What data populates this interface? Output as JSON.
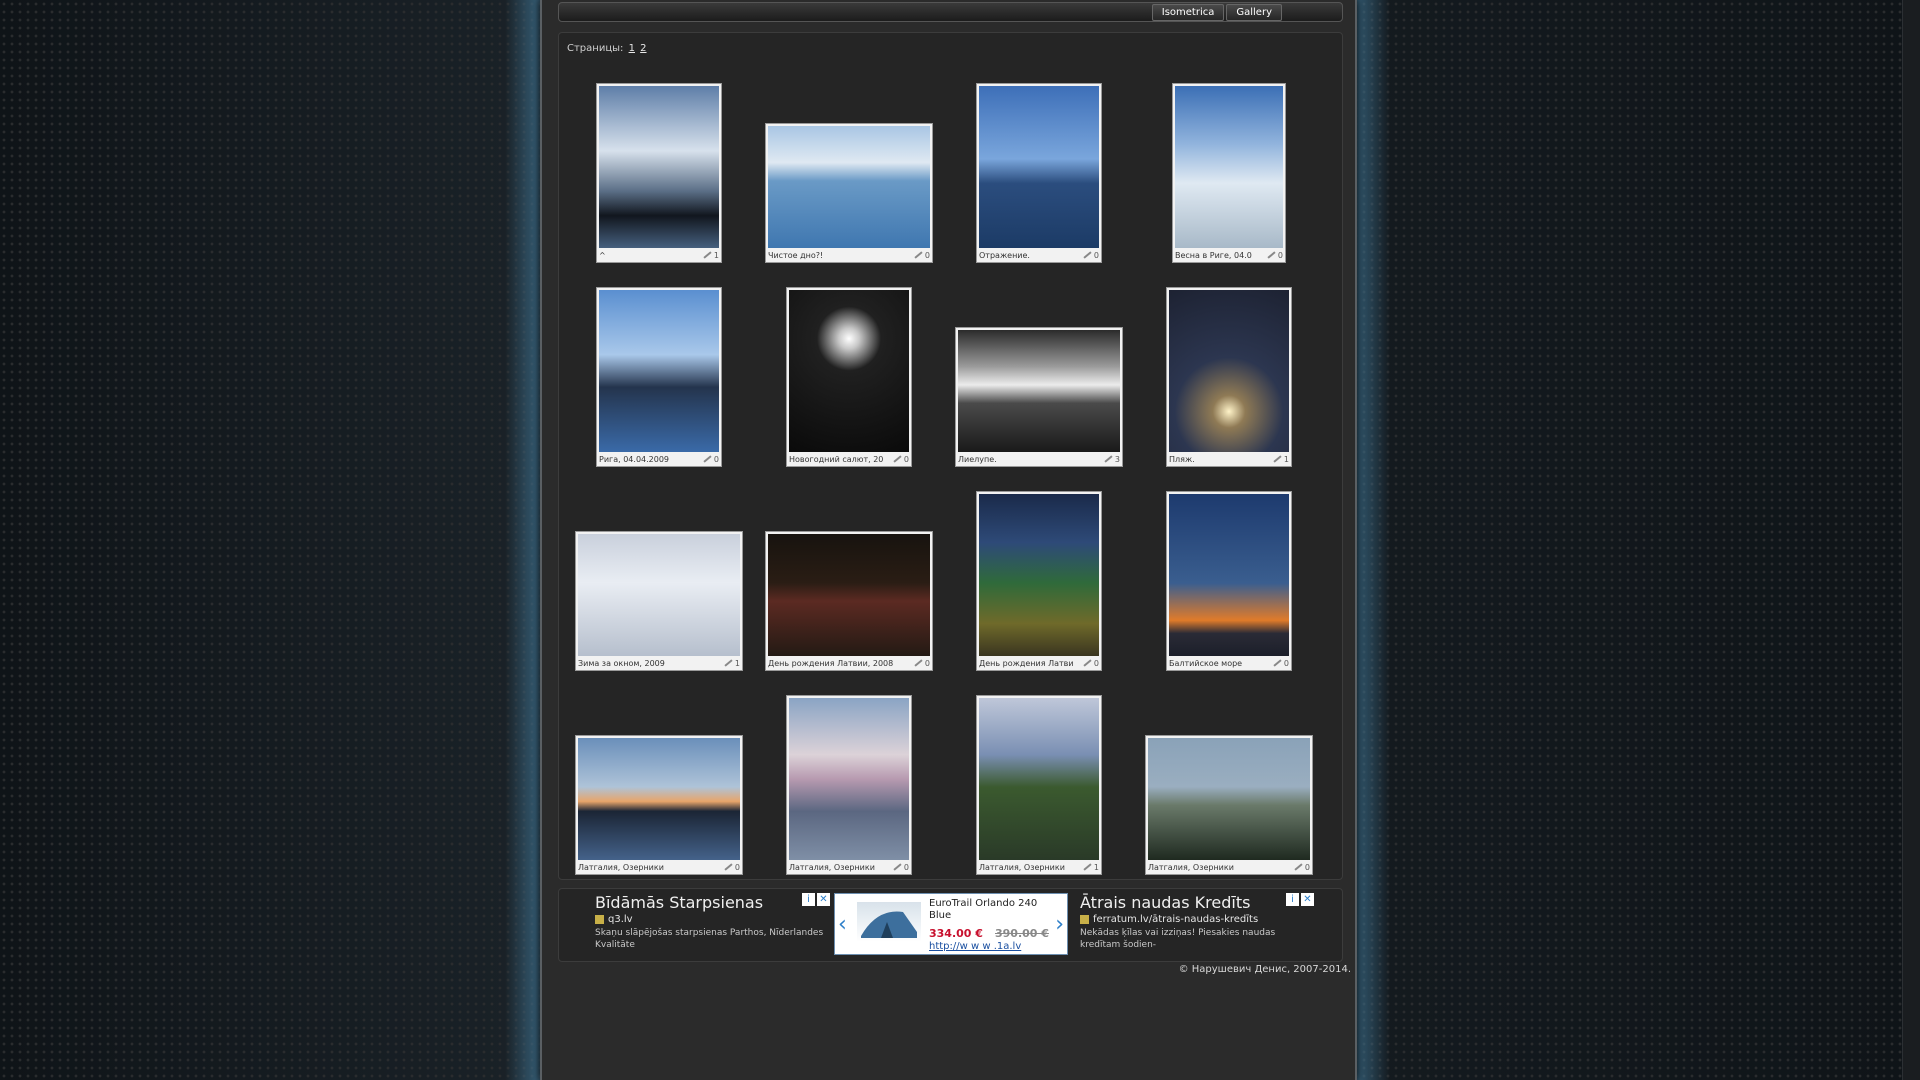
{
  "nav": {
    "tabs": [
      "Isometrica",
      "Gallery"
    ]
  },
  "pager": {
    "label": "Страницы:",
    "pages": [
      "1",
      "2"
    ]
  },
  "photos": [
    {
      "caption": "^",
      "comments": "1"
    },
    {
      "caption": "Чистое дно?!",
      "comments": "0"
    },
    {
      "caption": "Отражение.",
      "comments": "0"
    },
    {
      "caption": "Весна в Риге, 04.0",
      "comments": "0"
    },
    {
      "caption": "Рига, 04.04.2009",
      "comments": "0"
    },
    {
      "caption": "Новогодний салют, 20",
      "comments": "0"
    },
    {
      "caption": "Лиелупе.",
      "comments": "3"
    },
    {
      "caption": "Пляж.",
      "comments": "1"
    },
    {
      "caption": "Зима за окном, 2009",
      "comments": "1"
    },
    {
      "caption": "День рождения Латвии, 2008",
      "comments": "0"
    },
    {
      "caption": "День рождения Латви",
      "comments": "0"
    },
    {
      "caption": "Балтийское море",
      "comments": "0"
    },
    {
      "caption": "Латгалия, Озерники",
      "comments": "0"
    },
    {
      "caption": "Латгалия, Озерники",
      "comments": "0"
    },
    {
      "caption": "Латгалия, Озерники",
      "comments": "1"
    },
    {
      "caption": "Латгалия, Озерники",
      "comments": "0"
    }
  ],
  "ads": {
    "left": {
      "title": "Bīdāmās Starpsienas",
      "source": "q3.lv",
      "desc": "Skaņu slāpējošas starpsienas Parthos, Nīderlandes Kvalitāte"
    },
    "center": {
      "product": "EuroTrail Orlando 240 Blue",
      "price": "334.00 €",
      "old_price": "390.00 €",
      "url": "http://w w w .1a.lv"
    },
    "right": {
      "title": "Ātrais naudas Kredīts",
      "source": "ferratum.lv/ātrais-naudas-kredīts",
      "desc": "Nekādas ķīlas vai izziņas! Piesakies naudas kredītam šodien-"
    }
  },
  "footer": {
    "copyright": "© Нарушевич Денис, 2007-2014."
  }
}
